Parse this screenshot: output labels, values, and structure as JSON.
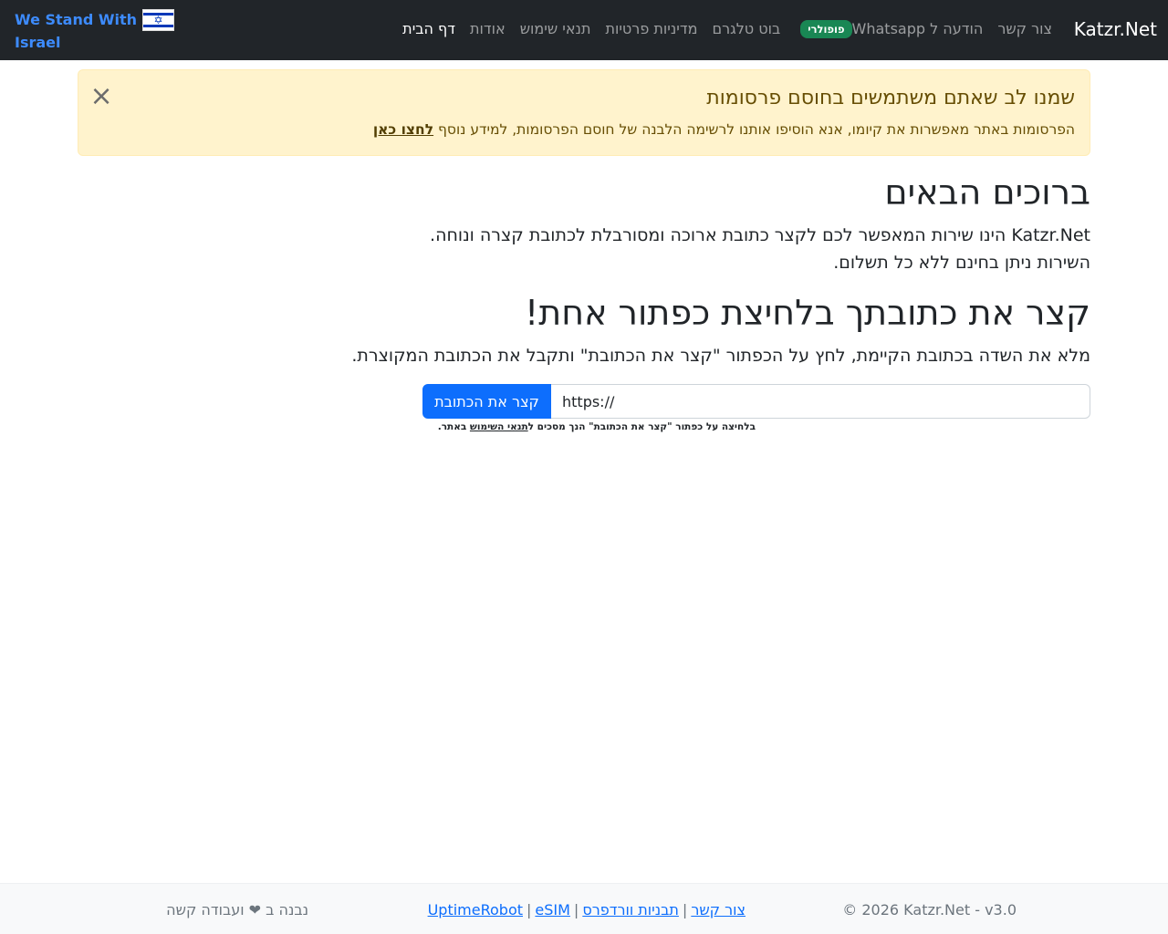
{
  "navbar": {
    "brand": "Katzr.Net",
    "links": [
      {
        "label": "דף הבית",
        "active": true
      },
      {
        "label": "אודות"
      },
      {
        "label": "תנאי שימוש"
      },
      {
        "label": "מדיניות פרטיות"
      },
      {
        "label": "בוט טלגרם"
      },
      {
        "label": "הודעה ל Whatsapp",
        "badge": "פופולרי"
      },
      {
        "label": "צור קשר"
      }
    ],
    "stand_with_israel": {
      "line1": "We Stand With",
      "line2": "Israel",
      "flag_icon": "israel-flag-icon"
    }
  },
  "alert": {
    "title": "שמנו לב שאתם משתמשים בחוסם פרסומות",
    "body": "הפרסומות באתר מאפשרות את קיומו, אנא הוסיפו אותנו לרשימה הלבנה של חוסם הפרסומות, למידע נוסף",
    "link": "לחצו כאן",
    "close_symbol": "×"
  },
  "main": {
    "title": "ברוכים הבאים",
    "lead_line1": "Katzr.Net הינו שירות המאפשר לכם לקצר כתובת ארוכה ומסורבלת לכתובת קצרה ונוחה.",
    "lead_line2": "השירות ניתן בחינם ללא כל תשלום.",
    "subtitle": "קצר את כתובתך בלחיצת כפתור אחת!",
    "instructions": "מלא את השדה בכתובת הקיימת, לחץ על הכפתור \"קצר את הכתובת\" ותקבל את הכתובת המקוצרת.",
    "url_input_value": "https://",
    "shorten_button": "קצר את הכתובת",
    "terms_prefix": "בלחיצה על כפתור \"קצר את הכתובת\" הנך מסכים ל",
    "terms_link": "תנאי השימוש",
    "terms_suffix": " באתר."
  },
  "footer": {
    "copyright": "© 2026 Katzr.Net - v3.0",
    "links": [
      "צור קשר",
      "תבניות וורדפרס",
      "UptimeRobot",
      "eSIM"
    ],
    "separator": "|",
    "made_with": "נבנה ב ❤ ועבודה קשה"
  },
  "colors": {
    "navbar_bg": "#212529",
    "alert_bg": "#fff3cd",
    "alert_text": "#664d03",
    "primary": "#0d6efd",
    "badge_green": "#198754",
    "stand_blue": "#3d8bfd"
  }
}
